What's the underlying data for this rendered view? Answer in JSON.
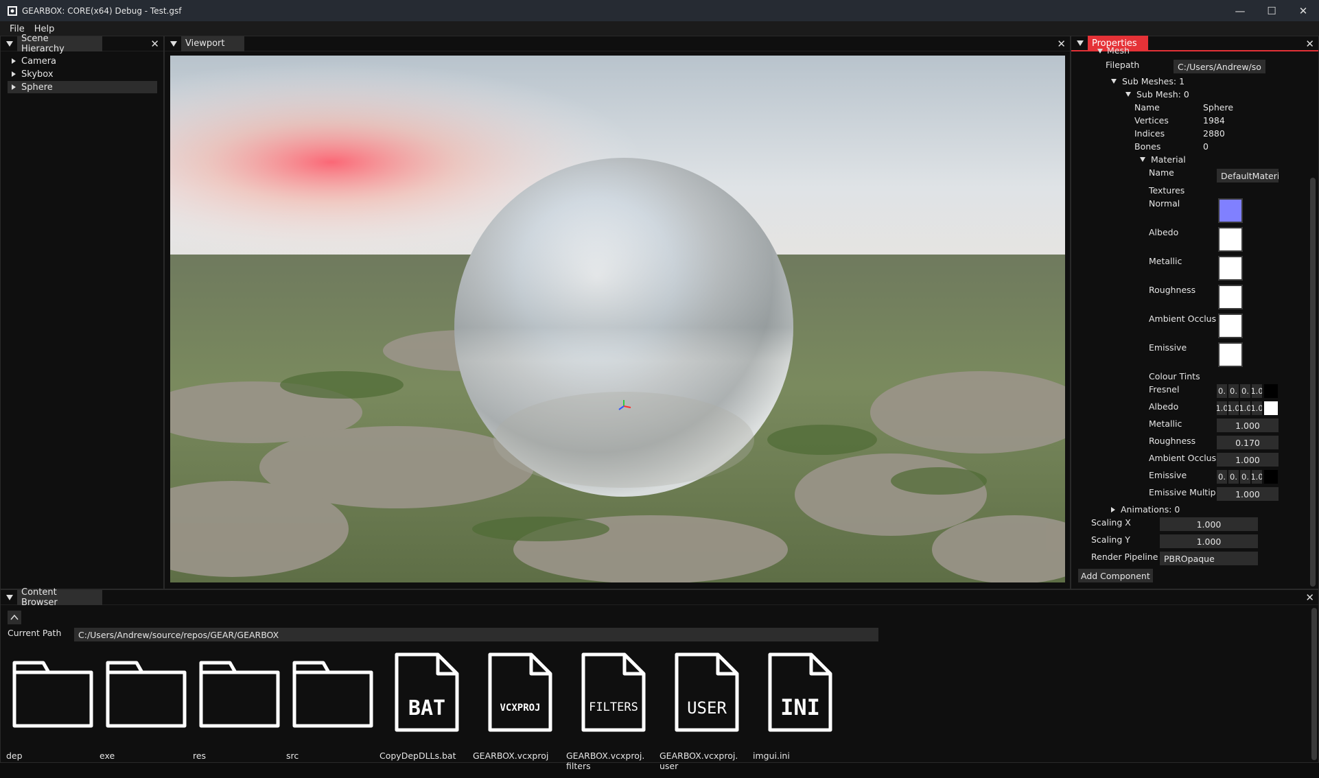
{
  "window": {
    "title": "GEARBOX: CORE(x64) Debug - Test.gsf",
    "minimize_glyph": "—",
    "maximize_glyph": "☐",
    "close_glyph": "✕"
  },
  "menu": {
    "file": "File",
    "help": "Help"
  },
  "scene_hierarchy": {
    "title": "Scene Hierarchy",
    "items": [
      {
        "label": "Camera"
      },
      {
        "label": "Skybox"
      },
      {
        "label": "Sphere"
      }
    ]
  },
  "viewport": {
    "title": "Viewport"
  },
  "properties": {
    "title": "Properties",
    "mesh_label": "Mesh",
    "filepath_label": "Filepath",
    "filepath_value": "C:/Users/Andrew/so",
    "sub_meshes_label": "Sub Meshes: 1",
    "sub_mesh_label": "Sub Mesh: 0",
    "name_label": "Name",
    "name_value": "Sphere",
    "vertices_label": "Vertices",
    "vertices_value": "1984",
    "indices_label": "Indices",
    "indices_value": "2880",
    "bones_label": "Bones",
    "bones_value": "0",
    "material_label": "Material",
    "material_name_label": "Name",
    "material_name_value": "DefaultMateria",
    "textures_label": "Textures",
    "textures": [
      {
        "label": "Normal",
        "color": "#8080ff"
      },
      {
        "label": "Albedo",
        "color": "#ffffff"
      },
      {
        "label": "Metallic",
        "color": "#ffffff"
      },
      {
        "label": "Roughness",
        "color": "#ffffff"
      },
      {
        "label": "Ambient Occlus",
        "color": "#ffffff"
      },
      {
        "label": "Emissive",
        "color": "#ffffff"
      }
    ],
    "colour_tints_label": "Colour Tints",
    "fresnel_label": "Fresnel",
    "fresnel_values": [
      "0.",
      "0.",
      "0.",
      "1.0"
    ],
    "fresnel_color": "#000000",
    "albedo_label": "Albedo",
    "albedo_values": [
      "1.0",
      "1.0",
      "1.0",
      "1.0"
    ],
    "albedo_color": "#ffffff",
    "metallic_label": "Metallic",
    "metallic_value": "1.000",
    "roughness_label": "Roughness",
    "roughness_value": "0.170",
    "ao_label": "Ambient Occlus",
    "ao_value": "1.000",
    "emissive_label": "Emissive",
    "emissive_values": [
      "0.",
      "0.",
      "0.",
      "1.0"
    ],
    "emissive_color": "#000000",
    "emissive_mult_label": "Emissive Multip",
    "emissive_mult_value": "1.000",
    "animations_label": "Animations: 0",
    "scaling_x_label": "Scaling X",
    "scaling_x_value": "1.000",
    "scaling_y_label": "Scaling Y",
    "scaling_y_value": "1.000",
    "render_pipeline_label": "Render Pipeline",
    "render_pipeline_value": "PBROpaque",
    "add_component_label": "Add Component"
  },
  "content_browser": {
    "title": "Content Browser",
    "current_path_label": "Current Path",
    "current_path_value": "C:/Users/Andrew/source/repos/GEAR/GEARBOX",
    "items": [
      {
        "type": "folder",
        "name": "dep"
      },
      {
        "type": "folder",
        "name": "exe"
      },
      {
        "type": "folder",
        "name": "res"
      },
      {
        "type": "folder",
        "name": "src"
      },
      {
        "type": "file",
        "ext": "BAT",
        "name": "CopyDepDLLs.bat"
      },
      {
        "type": "file",
        "ext": "VCXPROJ",
        "name": "GEARBOX.vcxproj"
      },
      {
        "type": "file",
        "ext": "FILTERS",
        "name": "GEARBOX.vcxproj.\nfilters"
      },
      {
        "type": "file",
        "ext": "USER",
        "name": "GEARBOX.vcxproj.\nuser"
      },
      {
        "type": "file",
        "ext": "INI",
        "name": "imgui.ini"
      }
    ]
  }
}
